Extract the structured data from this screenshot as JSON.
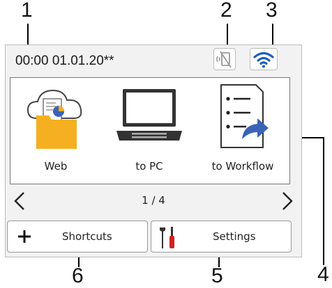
{
  "callouts": {
    "c1": "1",
    "c2": "2",
    "c3": "3",
    "c4": "4",
    "c5": "5",
    "c6": "6"
  },
  "status": {
    "datetime": "00:00  01.01.20**"
  },
  "apps": [
    {
      "label": "Web",
      "icon": "cloud-folder-icon"
    },
    {
      "label": "to PC",
      "icon": "laptop-icon"
    },
    {
      "label": "to Workflow",
      "icon": "workflow-list-icon"
    }
  ],
  "pager": {
    "indicator": "1 / 4"
  },
  "buttons": {
    "shortcuts": "Shortcuts",
    "settings": "Settings"
  },
  "colors": {
    "wifi": "#1e5fbf",
    "folder": "#f5b021",
    "arrow": "#3a63b8",
    "tool_red": "#d22020"
  }
}
